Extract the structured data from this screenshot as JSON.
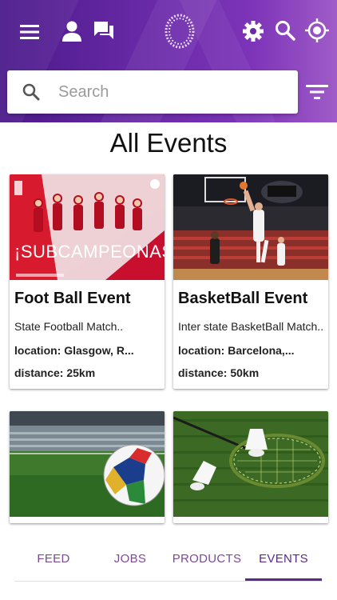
{
  "header": {
    "icons": [
      "menu-icon",
      "person-icon",
      "chat-icon",
      "logo",
      "gear-icon",
      "search-icon",
      "locate-icon",
      "filter-icon"
    ],
    "brand_color": "#6a2aa8"
  },
  "search": {
    "placeholder": "Search",
    "value": ""
  },
  "page": {
    "title": "All Events"
  },
  "events": [
    {
      "title": "Foot Ball Event",
      "subtitle": "State Football Match..",
      "location_label": "location:",
      "location_value": "Glasgow, R...",
      "distance_label": "distance:",
      "distance_value": "25km",
      "image_text": "¡SUBCAMPEONAS!"
    },
    {
      "title": "BasketBall Event",
      "subtitle": "Inter state BasketBall Match..",
      "location_label": "location:",
      "location_value": "Barcelona,...",
      "distance_label": "distance:",
      "distance_value": "50km",
      "image_text": ""
    },
    {
      "title": "",
      "subtitle": ""
    },
    {
      "title": "",
      "subtitle": ""
    }
  ],
  "tabs": [
    {
      "label": "FEED",
      "active": false
    },
    {
      "label": "JOBS",
      "active": false
    },
    {
      "label": "PRODUCTS",
      "active": false
    },
    {
      "label": "EVENTS",
      "active": true
    }
  ],
  "colors": {
    "accent": "#5a2a8c",
    "tab_text": "#7a4a94"
  }
}
